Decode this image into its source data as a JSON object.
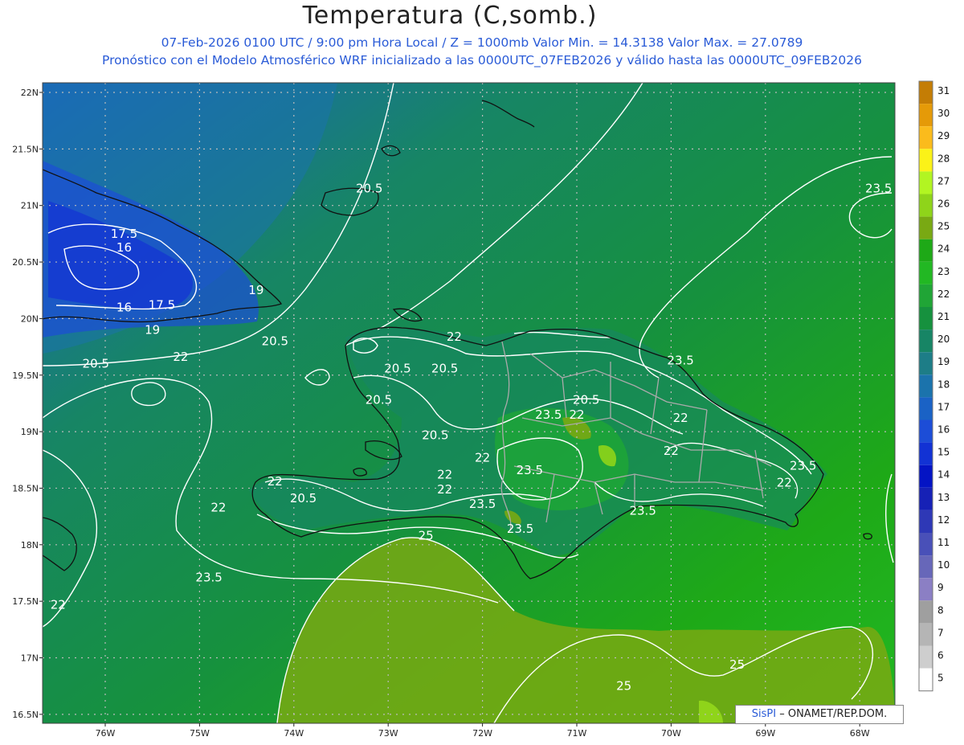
{
  "header": {
    "title": "Temperatura (C,somb.)",
    "line1": "07-Feb-2026  0100 UTC / 9:00 pm Hora Local / Z = 1000mb    Valor Min. = 14.3138  Valor Max. = 27.0789",
    "line2": "Pronóstico con el Modelo Atmosférico WRF inicializado a las 0000UTC_07FEB2026 y válido hasta las  0000UTC_09FEB2026"
  },
  "map": {
    "lat_labels": [
      "22N",
      "21.5N",
      "21N",
      "20.5N",
      "20N",
      "19.5N",
      "19N",
      "18.5N",
      "18N",
      "17.5N",
      "17N",
      "16.5N"
    ],
    "lon_labels": [
      "76W",
      "75W",
      "74W",
      "73W",
      "72W",
      "71W",
      "70W",
      "69W",
      "68W"
    ],
    "contour_labels": [
      {
        "text": "20.5",
        "lon": -73.2,
        "lat": 21.15
      },
      {
        "text": "23.5",
        "lon": -67.8,
        "lat": 21.15
      },
      {
        "text": "17.5",
        "lon": -75.8,
        "lat": 20.75
      },
      {
        "text": "16",
        "lon": -75.8,
        "lat": 20.63
      },
      {
        "text": "19",
        "lon": -74.4,
        "lat": 20.25
      },
      {
        "text": "16",
        "lon": -75.8,
        "lat": 20.1
      },
      {
        "text": "17.5",
        "lon": -75.4,
        "lat": 20.12
      },
      {
        "text": "19",
        "lon": -75.5,
        "lat": 19.9
      },
      {
        "text": "20.5",
        "lon": -74.2,
        "lat": 19.8
      },
      {
        "text": "20.5",
        "lon": -76.1,
        "lat": 19.6
      },
      {
        "text": "22",
        "lon": -75.2,
        "lat": 19.66
      },
      {
        "text": "22",
        "lon": -72.3,
        "lat": 19.84
      },
      {
        "text": "20.5",
        "lon": -72.9,
        "lat": 19.56
      },
      {
        "text": "20.5",
        "lon": -72.4,
        "lat": 19.56
      },
      {
        "text": "23.5",
        "lon": -69.9,
        "lat": 19.63
      },
      {
        "text": "20.5",
        "lon": -73.1,
        "lat": 19.28
      },
      {
        "text": "20.5",
        "lon": -70.9,
        "lat": 19.28
      },
      {
        "text": "23.5",
        "lon": -71.3,
        "lat": 19.15
      },
      {
        "text": "22",
        "lon": -71.0,
        "lat": 19.15
      },
      {
        "text": "22",
        "lon": -69.9,
        "lat": 19.12
      },
      {
        "text": "20.5",
        "lon": -72.5,
        "lat": 18.97
      },
      {
        "text": "22",
        "lon": -70.0,
        "lat": 18.83
      },
      {
        "text": "22",
        "lon": -72.0,
        "lat": 18.77
      },
      {
        "text": "23.5",
        "lon": -71.5,
        "lat": 18.66
      },
      {
        "text": "23.5",
        "lon": -68.6,
        "lat": 18.7
      },
      {
        "text": "22",
        "lon": -72.4,
        "lat": 18.62
      },
      {
        "text": "22",
        "lon": -74.2,
        "lat": 18.56
      },
      {
        "text": "22",
        "lon": -72.4,
        "lat": 18.49
      },
      {
        "text": "22",
        "lon": -68.8,
        "lat": 18.55
      },
      {
        "text": "20.5",
        "lon": -73.9,
        "lat": 18.41
      },
      {
        "text": "23.5",
        "lon": -72.0,
        "lat": 18.36
      },
      {
        "text": "22",
        "lon": -74.8,
        "lat": 18.33
      },
      {
        "text": "23.5",
        "lon": -70.3,
        "lat": 18.3
      },
      {
        "text": "23.5",
        "lon": -71.6,
        "lat": 18.14
      },
      {
        "text": "25",
        "lon": -72.6,
        "lat": 18.08
      },
      {
        "text": "23.5",
        "lon": -74.9,
        "lat": 17.71
      },
      {
        "text": "22",
        "lon": -76.5,
        "lat": 17.47
      },
      {
        "text": "25",
        "lon": -69.3,
        "lat": 16.94
      },
      {
        "text": "25",
        "lon": -70.5,
        "lat": 16.75
      }
    ],
    "colors": {
      "land_border": "#111111",
      "province_border": "#aaaaaa",
      "contour": "#ffffff",
      "grid": "#bbbbbb"
    }
  },
  "colorbar": {
    "labels": [
      "31",
      "30",
      "29",
      "28",
      "27",
      "26",
      "25",
      "24",
      "23",
      "22",
      "21",
      "20",
      "19",
      "18",
      "17",
      "16",
      "15",
      "14",
      "13",
      "12",
      "11",
      "10",
      "9",
      "8",
      "7",
      "6",
      "5"
    ],
    "colors": [
      "#c47d05",
      "#e59a08",
      "#fbbb1c",
      "#fbf218",
      "#b2f522",
      "#8fd41a",
      "#79a913",
      "#1ea917",
      "#22b823",
      "#20a536",
      "#16913e",
      "#178565",
      "#1d7d87",
      "#1b73ac",
      "#1a62c5",
      "#1c4dd7",
      "#1232d4",
      "#0414c4",
      "#1621b6",
      "#2e38b6",
      "#4950b8",
      "#6767b9",
      "#8b7fc4",
      "#9f9f9f",
      "#b5b5b5",
      "#cecece",
      "#ffffff"
    ]
  },
  "credit": {
    "brand": "SisPI",
    "text": " – ONAMET/REP.DOM."
  }
}
